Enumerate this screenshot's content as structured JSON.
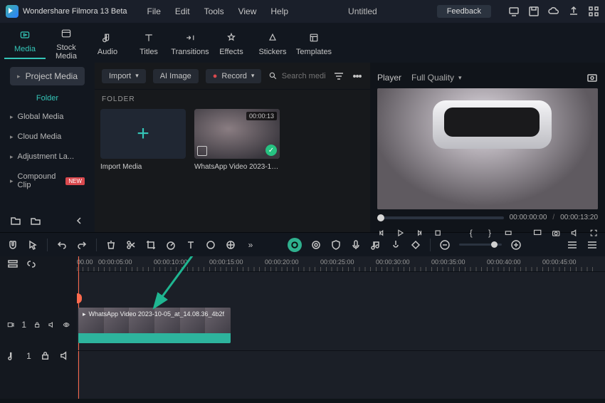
{
  "app": {
    "name": "Wondershare Filmora 13 Beta"
  },
  "menu": {
    "file": "File",
    "edit": "Edit",
    "tools": "Tools",
    "view": "View",
    "help": "Help"
  },
  "doc": {
    "title": "Untitled"
  },
  "topbar": {
    "feedback": "Feedback"
  },
  "ribbon": {
    "media": "Media",
    "stock": "Stock Media",
    "audio": "Audio",
    "titles": "Titles",
    "transitions": "Transitions",
    "effects": "Effects",
    "stickers": "Stickers",
    "templates": "Templates"
  },
  "sidebar": {
    "project": "Project Media",
    "folder": "Folder",
    "items": [
      {
        "label": "Global Media"
      },
      {
        "label": "Cloud Media"
      },
      {
        "label": "Adjustment La..."
      },
      {
        "label": "Compound Clip",
        "badge": "NEW"
      }
    ]
  },
  "toolbar2": {
    "import": "Import",
    "aiimage": "AI Image",
    "record": "Record",
    "search_placeholder": "Search media"
  },
  "content": {
    "folder_header": "FOLDER",
    "import_label": "Import Media",
    "clip_label": "WhatsApp Video 2023-10-05...",
    "clip_duration": "00:00:13"
  },
  "player": {
    "title": "Player",
    "quality": "Full Quality",
    "time_current": "00:00:00:00",
    "time_total": "00:00:13:20"
  },
  "timeline": {
    "start": "00.00",
    "local_zero": "00:00",
    "ticks": [
      "00:00:05:00",
      "00:00:10:00",
      "00:00:15:00",
      "00:00:20:00",
      "00:00:25:00",
      "00:00:30:00",
      "00:00:35:00",
      "00:00:40:00",
      "00:00:45:00"
    ],
    "video_track": "1",
    "audio_track": "1",
    "clip_label": "WhatsApp Video 2023-10-05_at_14.08.36_4b2f..."
  }
}
